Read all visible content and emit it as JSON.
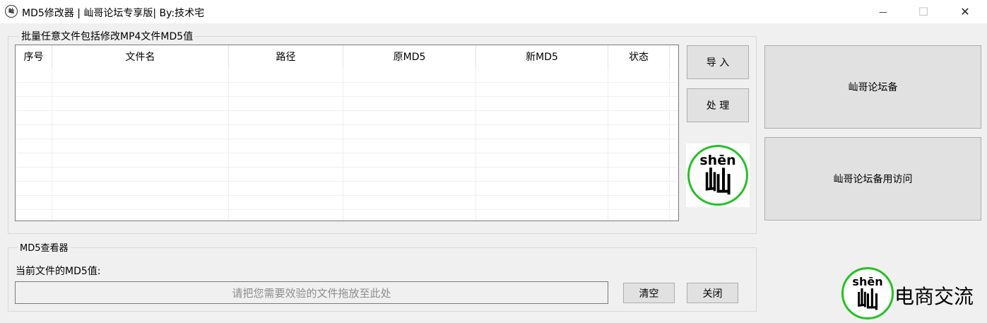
{
  "window": {
    "title": "MD5修改器 | 屾哥论坛专享版| By:技术宅",
    "icon": "app-logo-icon",
    "app_icon_char": "屾",
    "minimize_glyph": "—",
    "maximize_glyph": "☐",
    "close_glyph": "✕"
  },
  "batch_group": {
    "legend": "批量任意文件包括修改MP4文件MD5值",
    "columns": [
      "序号",
      "文件名",
      "路径",
      "原MD5",
      "新MD5",
      "状态"
    ],
    "rows": []
  },
  "buttons": {
    "import_label": "导 入",
    "process_label": "处 理",
    "forum_backup_label": "屾哥论坛备",
    "forum_alt_access_label": "屾哥论坛备用访问",
    "clear_label": "清空",
    "close_label": "关闭"
  },
  "logo": {
    "pinyin": "shēn",
    "char": "屾"
  },
  "viewer_group": {
    "legend": "MD5查看器",
    "current_label": "当前文件的MD5值:",
    "placeholder": "请把您需要效验的文件拖放至此处"
  },
  "brand": {
    "pinyin": "shēn",
    "char": "屾",
    "text": "电商交流",
    "accent_color": "#22c322"
  }
}
